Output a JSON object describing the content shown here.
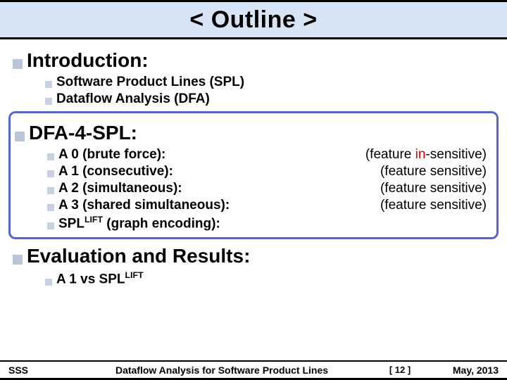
{
  "title": "< Outline >",
  "sections": {
    "intro": {
      "heading": "Introduction:",
      "items": [
        {
          "label": "Software Product Lines (SPL)"
        },
        {
          "label": "Dataflow Analysis (DFA)"
        }
      ]
    },
    "dfa4spl": {
      "heading": "DFA-4-SPL:",
      "items": [
        {
          "label": "A 0 (brute force):",
          "note_pre": "(feature ",
          "note_in": "in",
          "note_post": "-sensitive)"
        },
        {
          "label": "A 1 (consecutive):",
          "note_plain": "(feature sensitive)"
        },
        {
          "label": "A 2 (simultaneous):",
          "note_plain": "(feature sensitive)"
        },
        {
          "label": "A 3 (shared simultaneous):",
          "note_plain": "(feature sensitive)"
        },
        {
          "label_pre": "SPL",
          "label_sup": "LIFT",
          "label_post": " (graph encoding):"
        }
      ]
    },
    "eval": {
      "heading": "Evaluation and Results:",
      "items": [
        {
          "label_pre": "A 1 vs SPL",
          "label_sup": "LIFT",
          "label_post": ""
        }
      ]
    }
  },
  "footer": {
    "left": "SSS",
    "center": "Dataflow Analysis for Software Product Lines",
    "page": "[ 12 ]",
    "right": "May, 2013"
  }
}
